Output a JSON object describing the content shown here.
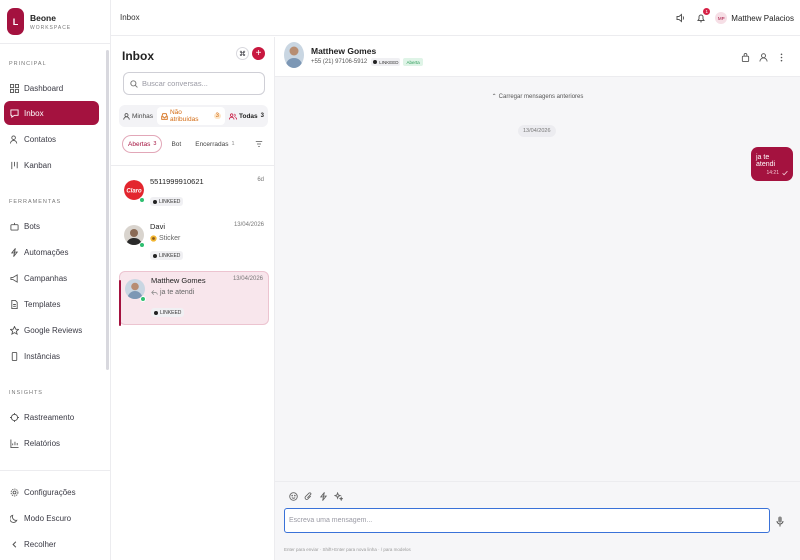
{
  "brand": {
    "logo_letter": "L",
    "name": "Beone",
    "subtitle": "WORKSPACE",
    "color": "#a4123f"
  },
  "sidebar": {
    "sections": [
      {
        "label": "PRINCIPAL",
        "items": [
          {
            "label": "Dashboard",
            "icon": "dashboard-icon"
          },
          {
            "label": "Inbox",
            "icon": "inbox-icon",
            "active": true
          },
          {
            "label": "Contatos",
            "icon": "contacts-icon"
          },
          {
            "label": "Kanban",
            "icon": "kanban-icon"
          }
        ]
      },
      {
        "label": "FERRAMENTAS",
        "items": [
          {
            "label": "Bots",
            "icon": "bot-icon"
          },
          {
            "label": "Automações",
            "icon": "lightning-icon"
          },
          {
            "label": "Campanhas",
            "icon": "megaphone-icon"
          },
          {
            "label": "Templates",
            "icon": "template-icon"
          },
          {
            "label": "Google Reviews",
            "icon": "star-icon"
          },
          {
            "label": "Instâncias",
            "icon": "phone-icon"
          }
        ]
      },
      {
        "label": "INSIGHTS",
        "items": [
          {
            "label": "Rastreamento",
            "icon": "tracking-icon"
          },
          {
            "label": "Relatórios",
            "icon": "chart-icon"
          }
        ]
      }
    ],
    "bottom": [
      {
        "label": "Configurações",
        "icon": "gear-icon"
      },
      {
        "label": "Modo Escuro",
        "icon": "moon-icon"
      },
      {
        "label": "Recolher",
        "icon": "chevron-left-icon"
      }
    ]
  },
  "topbar": {
    "breadcrumb": "Inbox",
    "notifications_count": "1",
    "user_initials": "MP",
    "user_name": "Matthew Palacios"
  },
  "inbox": {
    "title": "Inbox",
    "cmd_label": "⌘",
    "add_label": "+",
    "search_placeholder": "Buscar conversas...",
    "filters": [
      {
        "label": "Minhas",
        "count": "",
        "icon": "user-icon"
      },
      {
        "label": "Não atribuídas",
        "count": "3",
        "icon": "inbox-tray-icon"
      },
      {
        "label": "Todas",
        "count": "3",
        "icon": "users-icon"
      }
    ],
    "status_tabs": [
      {
        "label": "Abertas",
        "count": "3",
        "active": true
      },
      {
        "label": "Bot",
        "count": ""
      },
      {
        "label": "Encerradas",
        "count": "1"
      }
    ],
    "conversations": [
      {
        "name": "5511999910621",
        "time": "6d",
        "preview": "",
        "tag": "LINKEED",
        "avatar": "claro-logo"
      },
      {
        "name": "Davi",
        "time": "13/04/2026",
        "preview": "Sticker",
        "tag": "LINKEED",
        "avatar": "person-photo"
      },
      {
        "name": "Matthew Gomes",
        "time": "13/04/2026",
        "preview": "ja te atendi",
        "tag": "LINKEED",
        "avatar": "person-photo",
        "selected": true
      }
    ]
  },
  "chat": {
    "name": "Matthew Gomes",
    "phone": "+55 (21) 97106-5912",
    "tag": "LINKEED",
    "status": "Aberta",
    "load_more": "Carregar mensagens anteriores",
    "date": "13/04/2026",
    "messages": [
      {
        "text": "ja te atendi",
        "time": "14:21",
        "direction": "outgoing"
      }
    ],
    "input_placeholder": "Escreva uma mensagem...",
    "hint": "Enter para enviar · Shift+Enter para nova linha · / para modelos"
  }
}
